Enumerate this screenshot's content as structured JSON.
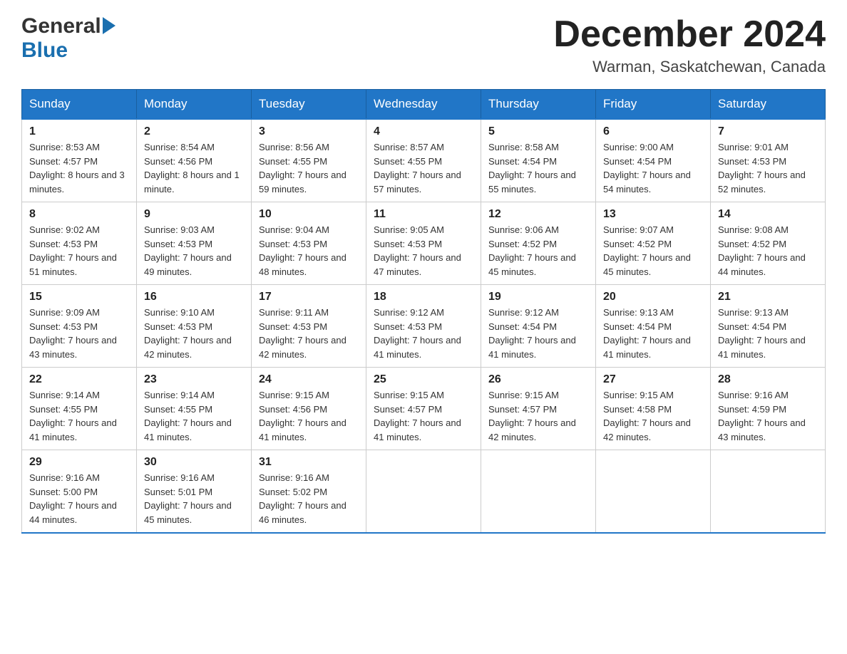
{
  "header": {
    "logo_general": "General",
    "logo_blue": "Blue",
    "month_title": "December 2024",
    "location": "Warman, Saskatchewan, Canada"
  },
  "calendar": {
    "days_of_week": [
      "Sunday",
      "Monday",
      "Tuesday",
      "Wednesday",
      "Thursday",
      "Friday",
      "Saturday"
    ],
    "weeks": [
      [
        {
          "day": "1",
          "sunrise": "8:53 AM",
          "sunset": "4:57 PM",
          "daylight": "8 hours and 3 minutes."
        },
        {
          "day": "2",
          "sunrise": "8:54 AM",
          "sunset": "4:56 PM",
          "daylight": "8 hours and 1 minute."
        },
        {
          "day": "3",
          "sunrise": "8:56 AM",
          "sunset": "4:55 PM",
          "daylight": "7 hours and 59 minutes."
        },
        {
          "day": "4",
          "sunrise": "8:57 AM",
          "sunset": "4:55 PM",
          "daylight": "7 hours and 57 minutes."
        },
        {
          "day": "5",
          "sunrise": "8:58 AM",
          "sunset": "4:54 PM",
          "daylight": "7 hours and 55 minutes."
        },
        {
          "day": "6",
          "sunrise": "9:00 AM",
          "sunset": "4:54 PM",
          "daylight": "7 hours and 54 minutes."
        },
        {
          "day": "7",
          "sunrise": "9:01 AM",
          "sunset": "4:53 PM",
          "daylight": "7 hours and 52 minutes."
        }
      ],
      [
        {
          "day": "8",
          "sunrise": "9:02 AM",
          "sunset": "4:53 PM",
          "daylight": "7 hours and 51 minutes."
        },
        {
          "day": "9",
          "sunrise": "9:03 AM",
          "sunset": "4:53 PM",
          "daylight": "7 hours and 49 minutes."
        },
        {
          "day": "10",
          "sunrise": "9:04 AM",
          "sunset": "4:53 PM",
          "daylight": "7 hours and 48 minutes."
        },
        {
          "day": "11",
          "sunrise": "9:05 AM",
          "sunset": "4:53 PM",
          "daylight": "7 hours and 47 minutes."
        },
        {
          "day": "12",
          "sunrise": "9:06 AM",
          "sunset": "4:52 PM",
          "daylight": "7 hours and 45 minutes."
        },
        {
          "day": "13",
          "sunrise": "9:07 AM",
          "sunset": "4:52 PM",
          "daylight": "7 hours and 45 minutes."
        },
        {
          "day": "14",
          "sunrise": "9:08 AM",
          "sunset": "4:52 PM",
          "daylight": "7 hours and 44 minutes."
        }
      ],
      [
        {
          "day": "15",
          "sunrise": "9:09 AM",
          "sunset": "4:53 PM",
          "daylight": "7 hours and 43 minutes."
        },
        {
          "day": "16",
          "sunrise": "9:10 AM",
          "sunset": "4:53 PM",
          "daylight": "7 hours and 42 minutes."
        },
        {
          "day": "17",
          "sunrise": "9:11 AM",
          "sunset": "4:53 PM",
          "daylight": "7 hours and 42 minutes."
        },
        {
          "day": "18",
          "sunrise": "9:12 AM",
          "sunset": "4:53 PM",
          "daylight": "7 hours and 41 minutes."
        },
        {
          "day": "19",
          "sunrise": "9:12 AM",
          "sunset": "4:54 PM",
          "daylight": "7 hours and 41 minutes."
        },
        {
          "day": "20",
          "sunrise": "9:13 AM",
          "sunset": "4:54 PM",
          "daylight": "7 hours and 41 minutes."
        },
        {
          "day": "21",
          "sunrise": "9:13 AM",
          "sunset": "4:54 PM",
          "daylight": "7 hours and 41 minutes."
        }
      ],
      [
        {
          "day": "22",
          "sunrise": "9:14 AM",
          "sunset": "4:55 PM",
          "daylight": "7 hours and 41 minutes."
        },
        {
          "day": "23",
          "sunrise": "9:14 AM",
          "sunset": "4:55 PM",
          "daylight": "7 hours and 41 minutes."
        },
        {
          "day": "24",
          "sunrise": "9:15 AM",
          "sunset": "4:56 PM",
          "daylight": "7 hours and 41 minutes."
        },
        {
          "day": "25",
          "sunrise": "9:15 AM",
          "sunset": "4:57 PM",
          "daylight": "7 hours and 41 minutes."
        },
        {
          "day": "26",
          "sunrise": "9:15 AM",
          "sunset": "4:57 PM",
          "daylight": "7 hours and 42 minutes."
        },
        {
          "day": "27",
          "sunrise": "9:15 AM",
          "sunset": "4:58 PM",
          "daylight": "7 hours and 42 minutes."
        },
        {
          "day": "28",
          "sunrise": "9:16 AM",
          "sunset": "4:59 PM",
          "daylight": "7 hours and 43 minutes."
        }
      ],
      [
        {
          "day": "29",
          "sunrise": "9:16 AM",
          "sunset": "5:00 PM",
          "daylight": "7 hours and 44 minutes."
        },
        {
          "day": "30",
          "sunrise": "9:16 AM",
          "sunset": "5:01 PM",
          "daylight": "7 hours and 45 minutes."
        },
        {
          "day": "31",
          "sunrise": "9:16 AM",
          "sunset": "5:02 PM",
          "daylight": "7 hours and 46 minutes."
        },
        null,
        null,
        null,
        null
      ]
    ]
  }
}
